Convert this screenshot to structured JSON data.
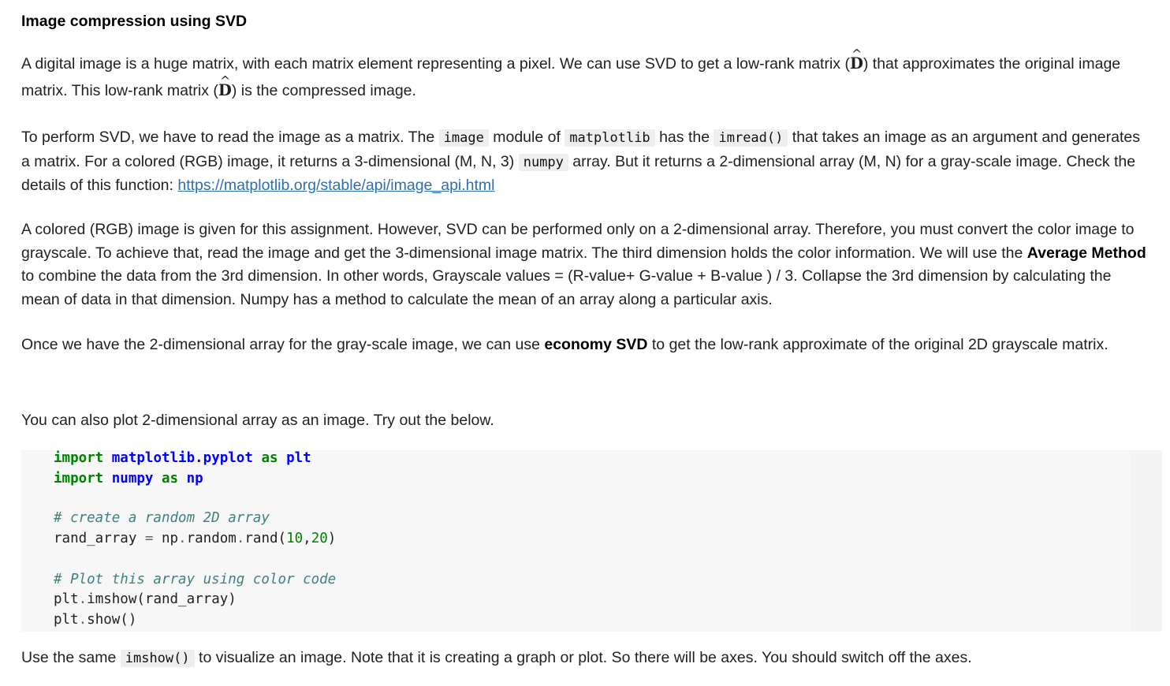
{
  "heading": "Image compression using SVD",
  "p1": {
    "t1": "A digital image is a huge matrix, with each matrix element representing a pixel. We can use SVD to get a low-rank matrix (",
    "sym": "D",
    "t2": ") that approximates the original image matrix. This low-rank matrix (",
    "t3": ") is the compressed image."
  },
  "p2": {
    "t1": "To perform SVD, we have to read the image as a matrix. The ",
    "c1": "image",
    "t2": " module of ",
    "c2": "matplotlib",
    "t3": " has the ",
    "c3": "imread()",
    "t4": " that takes an image as an argument and generates a matrix. For a colored (RGB) image, it returns a 3-dimensional (M, N, 3) ",
    "c4": "numpy",
    "t5": " array. But it returns a 2-dimensional array (M, N) for a gray-scale image. Check the details of this function: ",
    "link": "https://matplotlib.org/stable/api/image_api.html"
  },
  "p3": {
    "t1": "A colored (RGB) image is given for this assignment. However, SVD can be performed only on a 2-dimensional array. Therefore, you must convert the color image to grayscale. To achieve that, read the image and get the 3-dimensional image matrix. The third dimension holds the color information. We will use the ",
    "b1": "Average Method",
    "t2": " to combine the data from the 3rd dimension. In other words, Grayscale values = (R-value+ G-value + B-value ) / 3. Collapse the 3rd dimension by calculating the mean of data in that dimension. Numpy has a method to calculate the mean of an array along a particular axis."
  },
  "p4": {
    "t1": "Once we have the 2-dimensional array for the gray-scale image, we can use ",
    "b1": "economy SVD",
    "t2": " to get the low-rank approximate of the original 2D grayscale matrix."
  },
  "p5": "You can also plot 2-dimensional array as an image. Try out the below.",
  "code": {
    "l1": {
      "kw1": "import",
      "mod": "matplotlib.pyplot",
      "kw2": "as",
      "alias": "plt"
    },
    "l2": {
      "kw1": "import",
      "mod": "numpy",
      "kw2": "as",
      "alias": "np"
    },
    "l3": "# create a random 2D array",
    "l4": {
      "a": "rand_array ",
      "eq": "=",
      "b": " np",
      "dot1": ".",
      "c": "random",
      "dot2": ".",
      "d": "rand(",
      "n1": "10",
      "comma": ",",
      "n2": "20",
      "e": ")"
    },
    "l5": "# Plot this array using color code",
    "l6": {
      "a": "plt",
      "dot": ".",
      "b": "imshow(rand_array)"
    },
    "l7": {
      "a": "plt",
      "dot": ".",
      "b": "show()"
    }
  },
  "p6": {
    "t1": "Use the same ",
    "c1": "imshow()",
    "t2": " to visualize an image. Note that it is creating a graph or plot. So there will be axes. You should switch off the axes."
  }
}
